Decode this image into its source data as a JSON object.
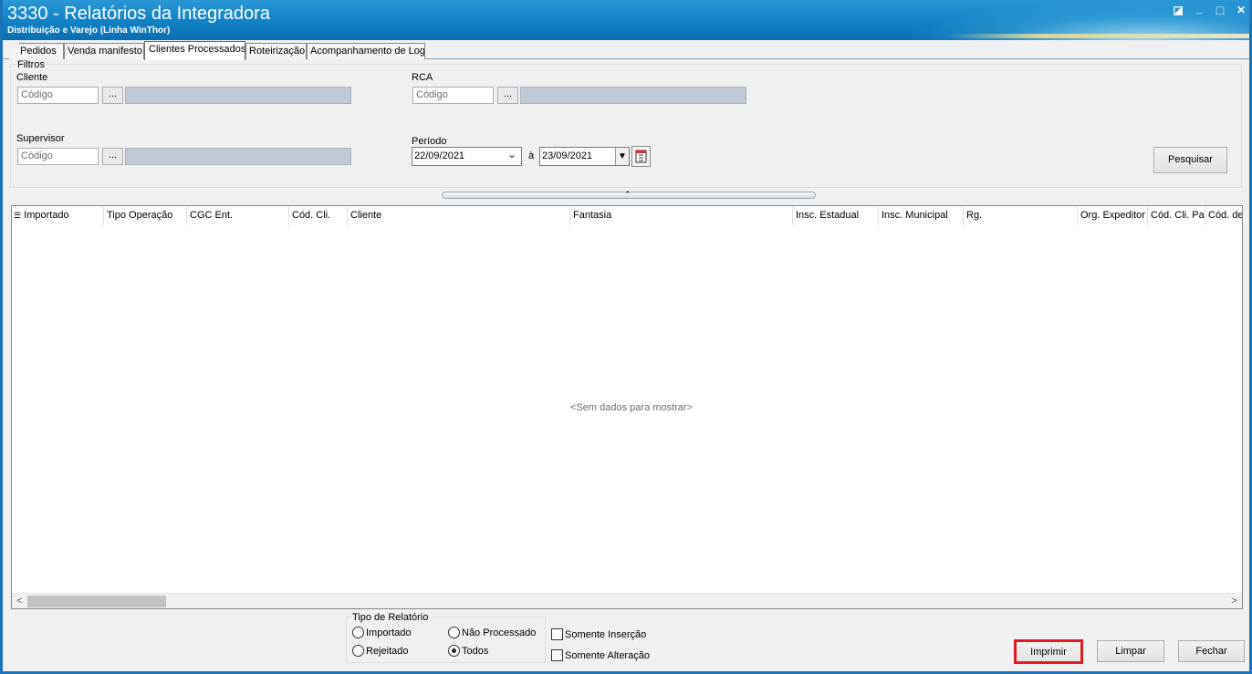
{
  "window": {
    "title": "3330 - Relatórios da Integradora",
    "subtitle": "Distribuição e Varejo (Linha WinThor)",
    "controls": {
      "restore": "◪",
      "minimize": "_",
      "maximize": "□",
      "close": "✕"
    }
  },
  "tabs": [
    "Pedidos",
    "Venda manifesto",
    "Clientes Processados",
    "Roteirização",
    "Acompanhamento de Log"
  ],
  "active_tab": "Clientes Processados",
  "filters": {
    "group_label": "Filtros",
    "cliente": {
      "label": "Cliente",
      "placeholder": "Código",
      "button": "..."
    },
    "rca": {
      "label": "RCA",
      "placeholder": "Código",
      "button": "..."
    },
    "supervisor": {
      "label": "Supervisor",
      "placeholder": "Código",
      "button": "..."
    },
    "periodo": {
      "label": "Período",
      "from": "22/09/2021",
      "separator": "à",
      "to": "23/09/2021"
    },
    "search_button": "Pesquisar"
  },
  "grid": {
    "columns": [
      "Importado",
      "Tipo Operação",
      "CGC Ent.",
      "Cód. Cli.",
      "Cliente",
      "Fantasia",
      "Insc. Estadual",
      "Insc. Municipal",
      "Rg.",
      "Org. Expeditor",
      "Cód. Cli. Pal",
      "Cód. de"
    ],
    "empty_text": "<Sem dados para mostrar>",
    "scroll_left": "<",
    "scroll_right": ">"
  },
  "report_type": {
    "label": "Tipo de Relatório",
    "options": [
      "Importado",
      "Não Processado",
      "Rejeitado",
      "Todos"
    ],
    "selected": "Todos"
  },
  "checkboxes": {
    "insert_only": "Somente Inserção",
    "change_only": "Somente Alteração"
  },
  "buttons": {
    "print": "Imprimir",
    "clear": "Limpar",
    "close": "Fechar"
  },
  "colors": {
    "titlebar": "#1283c7",
    "highlight": "#e21b22",
    "lookup_field": "#bfcad6"
  }
}
